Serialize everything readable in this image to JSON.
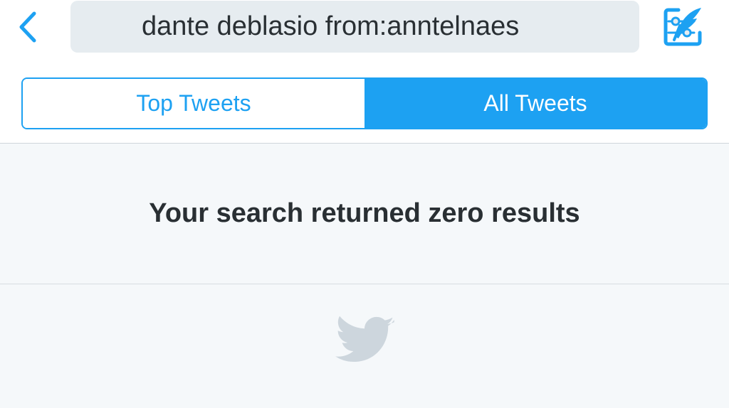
{
  "header": {
    "search_query": "dante deblasio from:anntelnaes",
    "back_icon": "chevron-left-icon",
    "filter_icon": "sliders-icon",
    "compose_icon": "compose-tweet-icon",
    "accent_color": "#1da1f2"
  },
  "tabs": [
    {
      "label": "Top Tweets",
      "selected": false
    },
    {
      "label": "All Tweets",
      "selected": true
    }
  ],
  "results": {
    "empty_message": "Your search returned zero results",
    "footer_icon": "twitter-bird-icon"
  }
}
